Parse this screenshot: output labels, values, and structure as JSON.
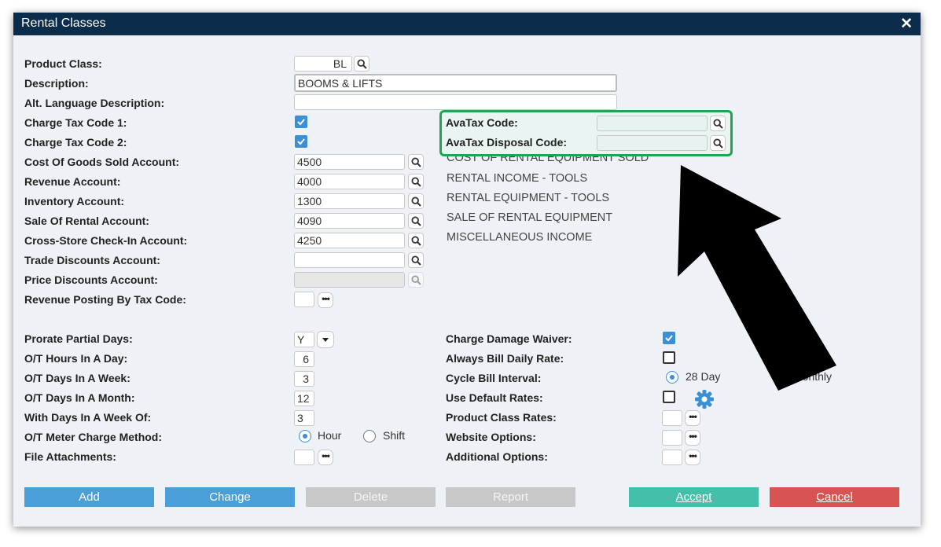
{
  "window": {
    "title": "Rental Classes"
  },
  "labels": {
    "product_class": "Product Class:",
    "description": "Description:",
    "alt_language_description": "Alt. Language Description:",
    "charge_tax_code_1": "Charge Tax Code 1:",
    "charge_tax_code_2": "Charge Tax Code 2:",
    "cogs_account": "Cost Of Goods Sold Account:",
    "revenue_account": "Revenue Account:",
    "inventory_account": "Inventory Account:",
    "sale_of_rental_account": "Sale Of Rental Account:",
    "cross_store_checkin_account": "Cross-Store Check-In Account:",
    "trade_discounts_account": "Trade Discounts Account:",
    "price_discounts_account": "Price Discounts Account:",
    "revenue_posting_by_tax_code": "Revenue Posting By Tax Code:",
    "avatax_code": "AvaTax Code:",
    "avatax_disposal_code": "AvaTax Disposal Code:",
    "prorate_partial_days": "Prorate Partial Days:",
    "ot_hours_in_a_day": "O/T Hours In A Day:",
    "ot_days_in_a_week": "O/T Days In A Week:",
    "ot_days_in_a_month": "O/T Days In A Month:",
    "with_days_in_a_week_of": "With Days In A Week Of:",
    "ot_meter_charge_method": "O/T Meter Charge Method:",
    "file_attachments": "File Attachments:",
    "charge_damage_waiver": "Charge Damage Waiver:",
    "always_bill_daily_rate": "Always Bill Daily Rate:",
    "cycle_bill_interval": "Cycle Bill Interval:",
    "use_default_rates": "Use Default Rates:",
    "product_class_rates": "Product Class Rates:",
    "website_options": "Website Options:",
    "additional_options": "Additional Options:"
  },
  "values": {
    "product_class": "BL",
    "description": "BOOMS & LIFTS",
    "alt_language_description": "",
    "cogs_account": "4500",
    "revenue_account": "4000",
    "inventory_account": "1300",
    "sale_of_rental_account": "4090",
    "cross_store_checkin_account": "4250",
    "trade_discounts_account": "",
    "price_discounts_account": "",
    "avatax_code": "",
    "avatax_disposal_code": "",
    "prorate_partial_days": "Y",
    "ot_hours_in_a_day": "6",
    "ot_days_in_a_week": "3",
    "ot_days_in_a_month": "12",
    "with_days_in_a_week_of": "3"
  },
  "account_names": {
    "cogs": "COST OF RENTAL EQUIPMENT SOLD",
    "revenue": "RENTAL INCOME - TOOLS",
    "inventory": "RENTAL EQUIPMENT - TOOLS",
    "sale_of_rental": "SALE OF RENTAL EQUIPMENT",
    "cross_store": "MISCELLANEOUS INCOME"
  },
  "checkboxes": {
    "charge_tax_code_1": true,
    "charge_tax_code_2": true,
    "charge_damage_waiver": true,
    "always_bill_daily_rate": false,
    "use_default_rates": false
  },
  "radios": {
    "meter_hour": "Hour",
    "meter_shift": "Shift",
    "meter_selected": "Hour",
    "cycle_28_day": "28 Day",
    "cycle_monthly": "Monthly",
    "cycle_selected": "28 Day"
  },
  "buttons": {
    "add": "Add",
    "change": "Change",
    "delete": "Delete",
    "report": "Report",
    "accept": "Accept",
    "cancel": "Cancel"
  },
  "colors": {
    "titlebar": "#0c2c4c",
    "accent_blue": "#4a9fd8",
    "highlight_green": "#1fa550",
    "accept": "#44bfa9",
    "cancel": "#d75452",
    "disabled": "#c8c8c8"
  },
  "icons": {
    "search": "magnifier-icon",
    "more": "ellipsis-icon",
    "settings": "gear-icon",
    "close": "close-icon",
    "annotation": "black-arrow-icon"
  }
}
